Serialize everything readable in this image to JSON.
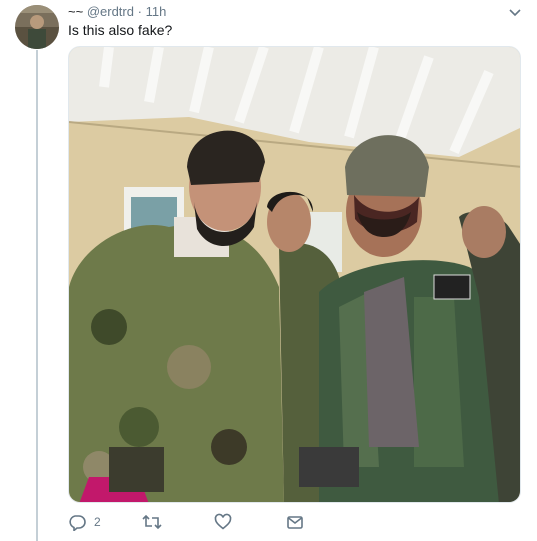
{
  "tweet": {
    "display_name": "~~",
    "handle": "@erdtrd",
    "separator": "·",
    "time": "11h",
    "text": "Is this also fake?"
  },
  "actions": {
    "reply_count": "2",
    "retweet_count": "",
    "like_count": ""
  },
  "colors": {
    "secondary_text": "#657786",
    "divider": "#e1e8ed",
    "thread_line": "#c4cfd6"
  },
  "icons": {
    "avatar": "avatar-image",
    "menu": "chevron-down-icon",
    "reply": "reply-icon",
    "retweet": "retweet-icon",
    "like": "heart-icon",
    "share": "mail-icon"
  }
}
